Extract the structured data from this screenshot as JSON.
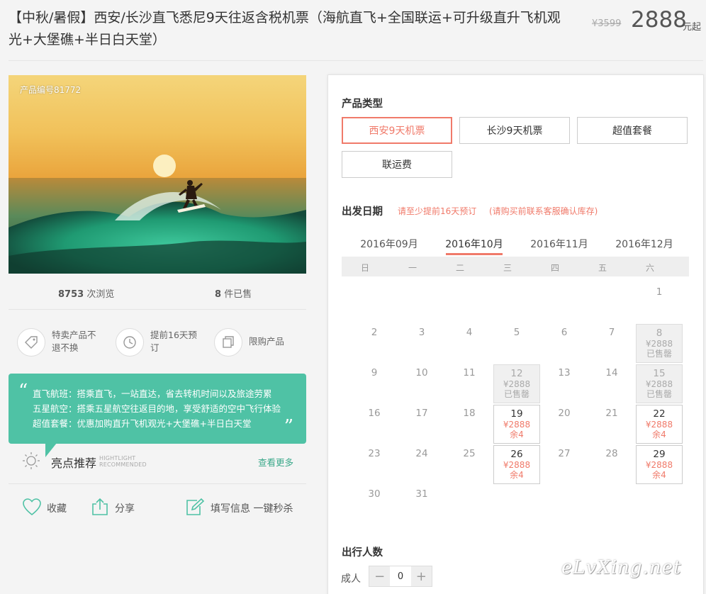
{
  "header": {
    "title": "【中秋/暑假】西安/长沙直飞悉尼9天往返含税机票（海航直飞+全国联运+可升级直升飞机观光+大堡礁+半日白天堂）",
    "old_price": "¥3599",
    "price": "2888",
    "price_unit": "元起"
  },
  "gallery": {
    "product_no": "产品编号81772"
  },
  "stats": {
    "views_count": "8753",
    "views_label": "次浏览",
    "sold_count": "8",
    "sold_label": "件已售"
  },
  "features": [
    {
      "icon": "tag-icon",
      "text": "特卖产品不退不换"
    },
    {
      "icon": "clock-icon",
      "text": "提前16天预订"
    },
    {
      "icon": "copy-icon",
      "text": "限购产品"
    }
  ],
  "highlight": {
    "lines": [
      "直飞航班：搭乘直飞，一站直达，省去转机时间以及旅途劳累",
      "五星航空：搭乘五星航空往返目的地，享受舒适的空中飞行体验",
      "超值套餐：优惠加购直升飞机观光+大堡礁+半日白天堂"
    ],
    "title": "亮点推荐",
    "title_en_1": "HIGHTLIGHT",
    "title_en_2": "RECOMMENDED",
    "more": "查看更多"
  },
  "actions": {
    "favorite": "收藏",
    "share": "分享",
    "fill_info": "填写信息 一键秒杀"
  },
  "booking": {
    "product_type_label": "产品类型",
    "options": [
      "西安9天机票",
      "长沙9天机票",
      "超值套餐",
      "联运费"
    ],
    "selected_option": 0,
    "date_label": "出发日期",
    "hint1": "请至少提前16天预订",
    "hint2": "(请购买前联系客服确认库存)",
    "months": [
      "2016年09月",
      "2016年10月",
      "2016年11月",
      "2016年12月"
    ],
    "active_month": 1,
    "weekdays": [
      "日",
      "一",
      "二",
      "三",
      "四",
      "五",
      "六"
    ],
    "days": [
      {
        "d": "1",
        "state": "plain"
      },
      {
        "d": "2",
        "state": "plain"
      },
      {
        "d": "3",
        "state": "plain"
      },
      {
        "d": "4",
        "state": "plain"
      },
      {
        "d": "5",
        "state": "plain"
      },
      {
        "d": "6",
        "state": "plain"
      },
      {
        "d": "7",
        "state": "plain"
      },
      {
        "d": "8",
        "state": "soldout",
        "price": "¥2888",
        "status": "已售罄"
      },
      {
        "d": "9",
        "state": "plain"
      },
      {
        "d": "10",
        "state": "plain"
      },
      {
        "d": "11",
        "state": "plain"
      },
      {
        "d": "12",
        "state": "soldout",
        "price": "¥2888",
        "status": "已售罄"
      },
      {
        "d": "13",
        "state": "plain"
      },
      {
        "d": "14",
        "state": "plain"
      },
      {
        "d": "15",
        "state": "soldout",
        "price": "¥2888",
        "status": "已售罄"
      },
      {
        "d": "16",
        "state": "plain"
      },
      {
        "d": "17",
        "state": "plain"
      },
      {
        "d": "18",
        "state": "plain"
      },
      {
        "d": "19",
        "state": "avail",
        "price": "¥2888",
        "status": "余4"
      },
      {
        "d": "20",
        "state": "plain"
      },
      {
        "d": "21",
        "state": "plain"
      },
      {
        "d": "22",
        "state": "avail",
        "price": "¥2888",
        "status": "余4"
      },
      {
        "d": "23",
        "state": "plain"
      },
      {
        "d": "24",
        "state": "plain"
      },
      {
        "d": "25",
        "state": "plain"
      },
      {
        "d": "26",
        "state": "avail",
        "price": "¥2888",
        "status": "余4"
      },
      {
        "d": "27",
        "state": "plain"
      },
      {
        "d": "28",
        "state": "plain"
      },
      {
        "d": "29",
        "state": "avail",
        "price": "¥2888",
        "status": "余4"
      },
      {
        "d": "30",
        "state": "plain"
      },
      {
        "d": "31",
        "state": "plain"
      }
    ],
    "first_weekday": 6,
    "people_label": "出行人数",
    "adult_label": "成人",
    "adult_count": "0",
    "minus": "−",
    "plus": "+"
  },
  "watermark": "eLvXing.net",
  "colors": {
    "accent": "#f07a6a",
    "highlight_bg": "#4fc2a5",
    "link": "#3aa88a"
  }
}
